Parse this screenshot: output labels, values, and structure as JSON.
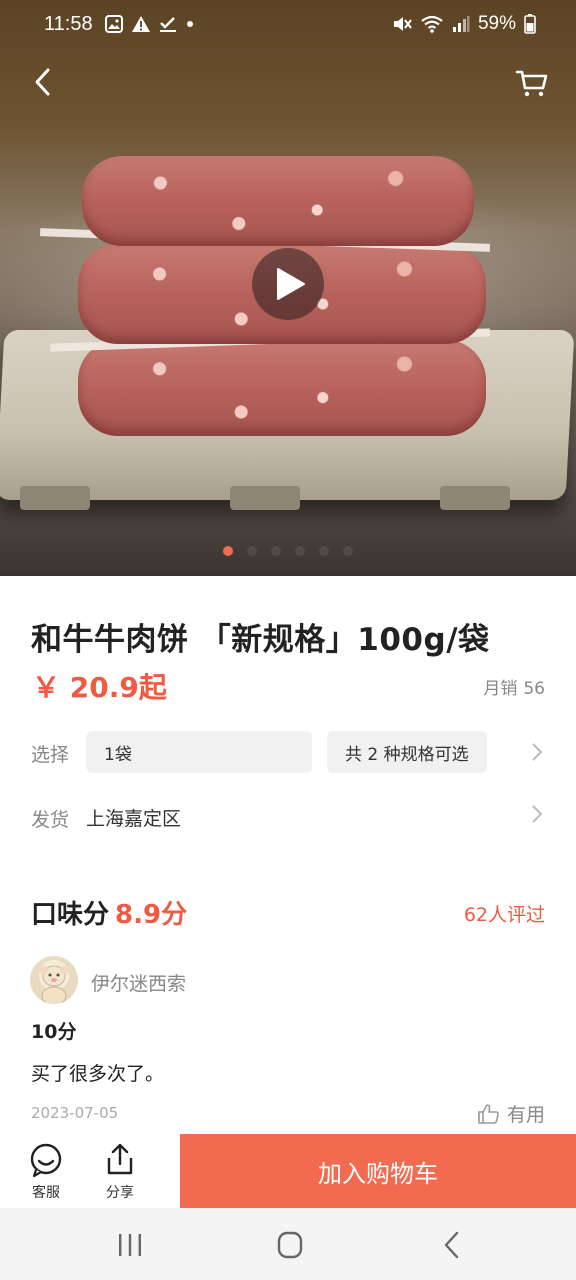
{
  "status_bar": {
    "time": "11:58",
    "battery": "59%"
  },
  "hero": {
    "slide_count": 6,
    "active_slide": 0
  },
  "product": {
    "title": "和牛牛肉饼 「新规格」100g/袋",
    "price": "￥ 20.9起",
    "monthly_sales_label": "月销",
    "monthly_sales_value": "56"
  },
  "options": {
    "select_label": "选择",
    "selected_spec": "1袋",
    "spec_count_text": "共 2 种规格可选",
    "ship_label": "发货",
    "ship_from": "上海嘉定区"
  },
  "taste": {
    "label": "口味分",
    "score": "8.9分",
    "review_count": "62人评过"
  },
  "review": {
    "reviewer": "伊尔迷西索",
    "score": "10分",
    "text": "买了很多次了。",
    "date": "2023-07-05",
    "useful_label": "有用"
  },
  "action_bar": {
    "service_label": "客服",
    "share_label": "分享",
    "add_to_cart_label": "加入购物车"
  },
  "colors": {
    "accent": "#f26a4f",
    "price": "#f05a43"
  }
}
